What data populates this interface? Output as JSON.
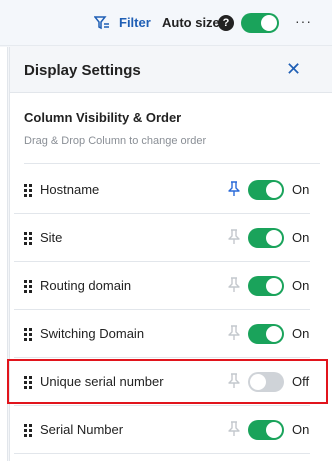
{
  "toolbar": {
    "filter_label": "Filter",
    "filter_icon": "filter-icon",
    "autosize_label": "Auto size",
    "help_glyph": "?",
    "autosize_on": true,
    "more_glyph": "···"
  },
  "panel": {
    "title": "Display Settings",
    "close_glyph": "✕",
    "section_title": "Column Visibility & Order",
    "section_subtitle": "Drag & Drop Column to change order"
  },
  "columns": [
    {
      "label": "Hostname",
      "pinned": true,
      "on": true,
      "state_label": "On"
    },
    {
      "label": "Site",
      "pinned": false,
      "on": true,
      "state_label": "On"
    },
    {
      "label": "Routing domain",
      "pinned": false,
      "on": true,
      "state_label": "On"
    },
    {
      "label": "Switching Domain",
      "pinned": false,
      "on": true,
      "state_label": "On"
    },
    {
      "label": "Unique serial number",
      "pinned": false,
      "on": false,
      "state_label": "Off"
    },
    {
      "label": "Serial Number",
      "pinned": false,
      "on": true,
      "state_label": "On"
    }
  ],
  "colors": {
    "accent": "#1f5fb5",
    "toggle_on": "#1aa35b",
    "toggle_off": "#cfd3d8",
    "pin_active": "#2a6ad8",
    "pin_inactive": "#c4c8cd",
    "highlight": "#e1141c"
  }
}
